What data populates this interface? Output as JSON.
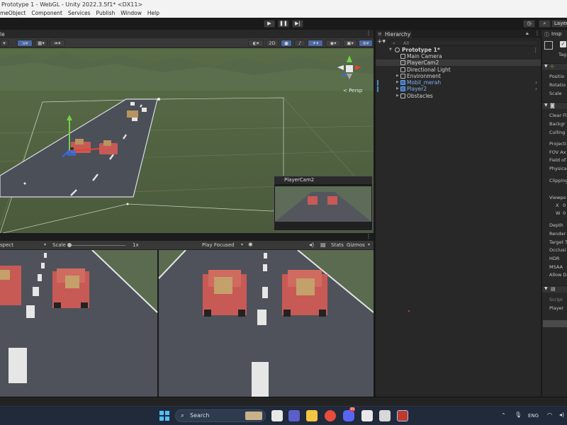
{
  "window": {
    "title": "Prototype 1 - WebGL - Unity 2022.3.5f1* <DX11>"
  },
  "menu": {
    "items": [
      "meObject",
      "Component",
      "Services",
      "Publish",
      "Window",
      "Help"
    ]
  },
  "toolbar": {
    "layers_label": "Layer"
  },
  "scene": {
    "tab_label": "le",
    "view_2d": "2D",
    "axis_label": "< Persp",
    "cam_preview_label": "PlayerCam2"
  },
  "game": {
    "aspect_label": "spect",
    "scale_label": "Scale",
    "scale_value": "1x",
    "play_mode_label": "Play Focused",
    "stats_label": "Stats",
    "gizmos_label": "Gizmos"
  },
  "hierarchy": {
    "tab_label": "Hierarchy",
    "search_placeholder": "All",
    "rows": [
      {
        "label": "Prototype 1*"
      },
      {
        "label": "Main Camera"
      },
      {
        "label": "PlayerCam2"
      },
      {
        "label": "Directional Light"
      },
      {
        "label": "Environment"
      },
      {
        "label": "Mobil_merah"
      },
      {
        "label": "Player2"
      },
      {
        "label": "Obstacles"
      }
    ]
  },
  "inspector": {
    "tab_label": "Insp",
    "tag_label": "Tag",
    "transform_fields": [
      "Positio",
      "Rotatio",
      "Scale"
    ],
    "camera_fields": [
      "Clear Fl",
      "Backgr",
      "Culling",
      "Projecti",
      "FOV Ax",
      "Field of",
      "Physica",
      "Clipping",
      "Viewpo",
      "X",
      "W",
      "Depth",
      "Render",
      "Target T",
      "Occlusi",
      "HDR",
      "MSAA",
      "Allow D"
    ],
    "viewport_values": [
      "0",
      "0"
    ],
    "script_fields": [
      "Script",
      "Player"
    ]
  },
  "taskbar": {
    "search_label": "Search",
    "lang": "ENG",
    "badge": "99"
  },
  "colors": {
    "accent": "#4b6aa3",
    "prefab_text": "#7cb0ef",
    "car_red": "#c85a55"
  }
}
